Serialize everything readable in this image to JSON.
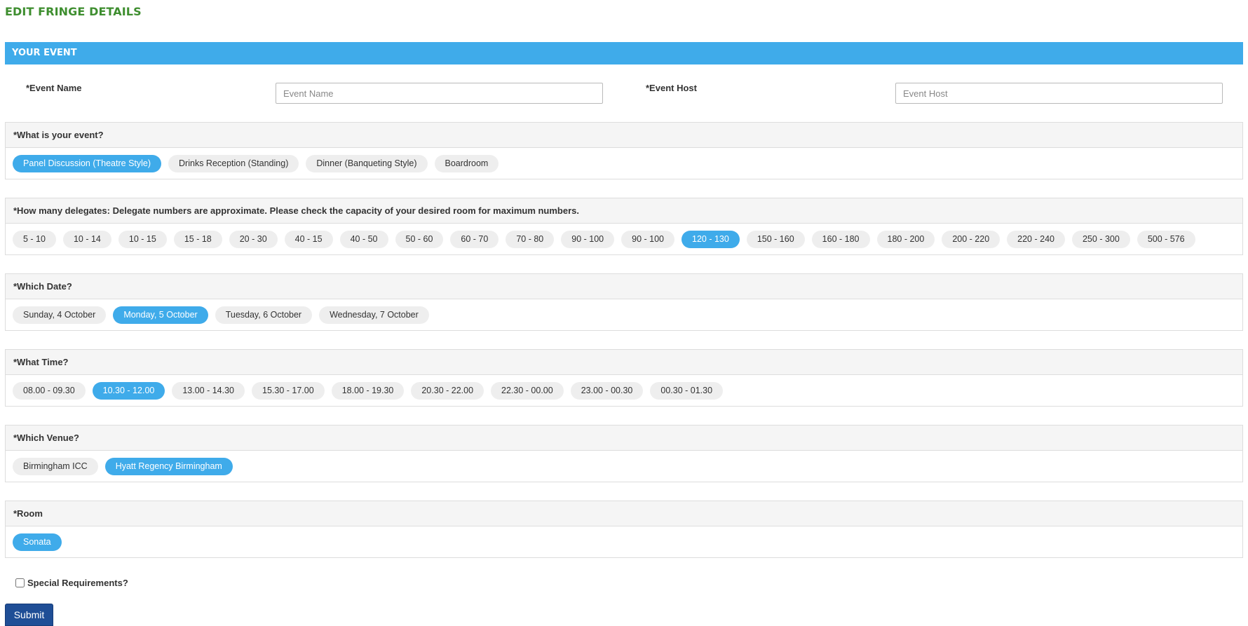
{
  "page": {
    "title": "EDIT FRINGE DETAILS"
  },
  "section": {
    "title": "YOUR EVENT"
  },
  "fields": {
    "event_name": {
      "label": "*Event Name",
      "placeholder": "Event Name",
      "value": ""
    },
    "event_host": {
      "label": "*Event Host",
      "placeholder": "Event Host",
      "value": ""
    }
  },
  "groups": [
    {
      "key": "event_type",
      "title": "*What is your event?",
      "selected": "Panel Discussion (Theatre Style)",
      "options": [
        "Panel Discussion (Theatre Style)",
        "Drinks Reception (Standing)",
        "Dinner (Banqueting Style)",
        "Boardroom"
      ]
    },
    {
      "key": "delegates",
      "title": "*How many delegates: Delegate numbers are approximate. Please check the capacity of your desired room for maximum numbers.",
      "selected": "120 - 130",
      "options": [
        "5 - 10",
        "10 - 14",
        "10 - 15",
        "15 - 18",
        "20 - 30",
        "40 - 15",
        "40 - 50",
        "50 - 60",
        "60 - 70",
        "70 - 80",
        "90 - 100",
        "90 - 100",
        "120 - 130",
        "150 - 160",
        "160 - 180",
        "180 - 200",
        "200 - 220",
        "220 - 240",
        "250 - 300",
        "500 - 576"
      ]
    },
    {
      "key": "date",
      "title": "*Which Date?",
      "selected": "Monday, 5 October",
      "options": [
        "Sunday, 4 October",
        "Monday, 5 October",
        "Tuesday, 6 October",
        "Wednesday, 7 October"
      ]
    },
    {
      "key": "time",
      "title": "*What Time?",
      "selected": "10.30 - 12.00",
      "options": [
        "08.00 - 09.30",
        "10.30 - 12.00",
        "13.00 - 14.30",
        "15.30 - 17.00",
        "18.00 - 19.30",
        "20.30 - 22.00",
        "22.30 - 00.00",
        "23.00 - 00.30",
        "00.30 - 01.30"
      ]
    },
    {
      "key": "venue",
      "title": "*Which Venue?",
      "selected": "Hyatt Regency Birmingham",
      "options": [
        "Birmingham ICC",
        "Hyatt Regency Birmingham"
      ]
    },
    {
      "key": "room",
      "title": "*Room",
      "selected": "Sonata",
      "options": [
        "Sonata"
      ]
    }
  ],
  "special_requirements": {
    "label": "Special Requirements?",
    "checked": false
  },
  "submit": {
    "label": "Submit"
  },
  "colors": {
    "accent": "#3fabea",
    "title": "#3e8e2f",
    "submit": "#1f4e96",
    "pill": "#eeeeee"
  }
}
